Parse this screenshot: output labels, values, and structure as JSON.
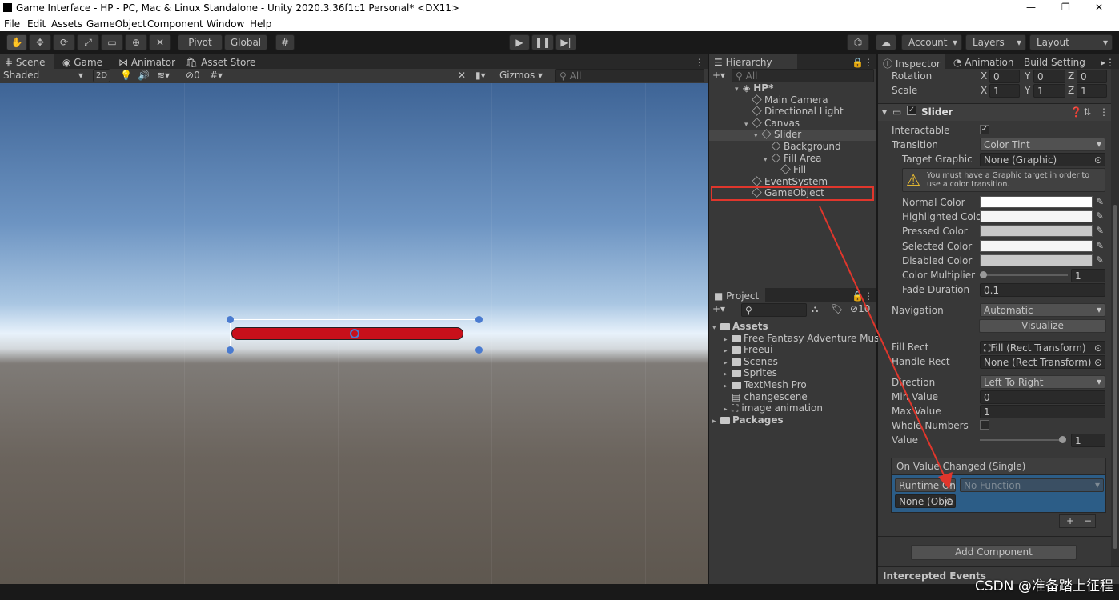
{
  "window": {
    "title": "Game Interface - HP - PC, Mac & Linux Standalone - Unity 2020.3.36f1c1 Personal* <DX11>",
    "minimize": "—",
    "maximize": "❐",
    "close": "✕"
  },
  "menu": [
    "File",
    "Edit",
    "Assets",
    "GameObject",
    "Component",
    "Window",
    "Help"
  ],
  "toolbar": {
    "pivot": "Pivot",
    "global": "Global",
    "account": "Account",
    "layers": "Layers",
    "layout": "Layout"
  },
  "scene": {
    "tabs": [
      "Scene",
      "Game",
      "Animator",
      "Asset Store"
    ],
    "shading": "Shaded",
    "mode2d": "2D",
    "hidden_count": "0",
    "gizmos": "Gizmos",
    "search_placeholder": "All",
    "slider_fill_color": "#c8101a"
  },
  "hierarchy": {
    "tab": "Hierarchy",
    "search_placeholder": "All",
    "items": [
      {
        "label": "HP*",
        "indent": 0
      },
      {
        "label": "Main Camera",
        "indent": 1
      },
      {
        "label": "Directional Light",
        "indent": 1
      },
      {
        "label": "Canvas",
        "indent": 1
      },
      {
        "label": "Slider",
        "indent": 2
      },
      {
        "label": "Background",
        "indent": 3
      },
      {
        "label": "Fill Area",
        "indent": 3
      },
      {
        "label": "Fill",
        "indent": 4
      },
      {
        "label": "EventSystem",
        "indent": 1
      },
      {
        "label": "GameObject",
        "indent": 1
      }
    ]
  },
  "project": {
    "tab": "Project",
    "count": "10",
    "items": [
      {
        "label": "Assets",
        "indent": 0,
        "type": "folder"
      },
      {
        "label": "Free Fantasy Adventure Music P",
        "indent": 1,
        "type": "folder"
      },
      {
        "label": "Freeui",
        "indent": 1,
        "type": "folder"
      },
      {
        "label": "Scenes",
        "indent": 1,
        "type": "folder"
      },
      {
        "label": "Sprites",
        "indent": 1,
        "type": "folder"
      },
      {
        "label": "TextMesh Pro",
        "indent": 1,
        "type": "folder"
      },
      {
        "label": "changescene",
        "indent": 1,
        "type": "script"
      },
      {
        "label": "image animation",
        "indent": 1,
        "type": "anim"
      },
      {
        "label": "Packages",
        "indent": 0,
        "type": "folder"
      }
    ]
  },
  "inspector": {
    "tabs": [
      "Inspector",
      "Animation",
      "Build Setting"
    ],
    "rotation": {
      "label": "Rotation",
      "x": "0",
      "y": "0",
      "z": "0"
    },
    "scale": {
      "label": "Scale",
      "x": "1",
      "y": "1",
      "z": "1"
    },
    "axis": {
      "x": "X",
      "y": "Y",
      "z": "Z"
    },
    "component": "Slider",
    "interactable_label": "Interactable",
    "transition_label": "Transition",
    "transition": "Color Tint",
    "target_graphic_label": "Target Graphic",
    "target_graphic": "None (Graphic)",
    "warning": "You must have a Graphic target in order to use a color transition.",
    "colors": [
      {
        "label": "Normal Color",
        "hex": "#ffffff"
      },
      {
        "label": "Highlighted Color",
        "hex": "#f5f5f5"
      },
      {
        "label": "Pressed Color",
        "hex": "#c8c8c8"
      },
      {
        "label": "Selected Color",
        "hex": "#f5f5f5"
      },
      {
        "label": "Disabled Color",
        "hex": "#c8c8c8"
      }
    ],
    "color_multiplier_label": "Color Multiplier",
    "color_multiplier": "1",
    "fade_label": "Fade Duration",
    "fade": "0.1",
    "navigation_label": "Navigation",
    "navigation": "Automatic",
    "visualize": "Visualize",
    "fill_rect_label": "Fill Rect",
    "fill_rect": "Fill (Rect Transform)",
    "handle_rect_label": "Handle Rect",
    "handle_rect": "None (Rect Transform)",
    "direction_label": "Direction",
    "direction": "Left To Right",
    "min_label": "Min Value",
    "min": "0",
    "max_label": "Max Value",
    "max": "1",
    "whole_label": "Whole Numbers",
    "value_label": "Value",
    "value": "1",
    "event_label": "On Value Changed (Single)",
    "runtime": "Runtime On",
    "no_function": "No Function",
    "none_obj": "None (Obje",
    "add_component": "Add Component",
    "intercepted": "Intercepted Events"
  },
  "watermark": "CSDN @准备踏上征程"
}
